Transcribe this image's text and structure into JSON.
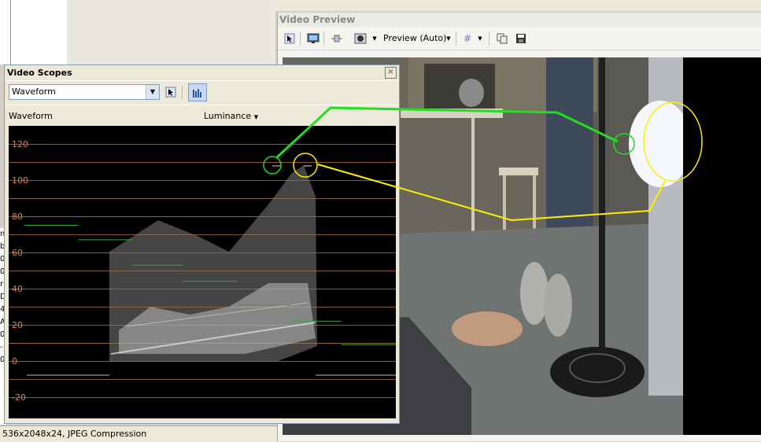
{
  "status_bar": {
    "text": "536x2048x24, JPEG Compression"
  },
  "side_list": {
    "chars": [
      "m",
      "b",
      "0",
      "0",
      "r",
      "D",
      "4",
      "A",
      "0",
      "-",
      "0"
    ]
  },
  "video_preview": {
    "title": "Video Preview",
    "preview_mode": "Preview (Auto)",
    "icons": [
      "select-arrow-icon",
      "monitor-icon",
      "split-screen-icon",
      "overlay-icon",
      "grid-icon",
      "copy-frame-icon",
      "save-frame-icon"
    ]
  },
  "video_scopes": {
    "title": "Video Scopes",
    "close_label": "×",
    "selected_scope": "Waveform",
    "panel_label": "Waveform",
    "channel_label": "Luminance",
    "y_ticks": [
      "120",
      "100",
      "80",
      "60",
      "40",
      "20",
      "0",
      "-20"
    ],
    "waveform_levels": [
      {
        "x_from": 0.04,
        "x_to": 0.18,
        "ire": 75
      },
      {
        "x_from": 0.18,
        "x_to": 0.32,
        "ire": 67
      },
      {
        "x_from": 0.32,
        "x_to": 0.45,
        "ire": 53
      },
      {
        "x_from": 0.45,
        "x_to": 0.59,
        "ire": 44
      },
      {
        "x_from": 0.59,
        "x_to": 0.73,
        "ire": 31
      },
      {
        "x_from": 0.73,
        "x_to": 0.86,
        "ire": 22
      },
      {
        "x_from": 0.86,
        "x_to": 1.0,
        "ire": 9
      }
    ]
  },
  "colors": {
    "accent_green": "#22dd22",
    "accent_yellow": "#ffee00",
    "grid_orange": "#8b5a2b",
    "label_orange": "#d9844e"
  }
}
